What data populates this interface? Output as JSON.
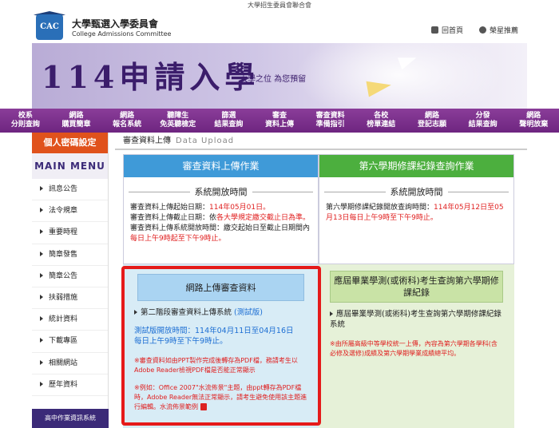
{
  "topbar": {
    "text": "大學招生委員會聯合會"
  },
  "header": {
    "logo_text": "CAC",
    "org_zh": "大學甄選入學委員會",
    "org_en": "College Admissions Committee",
    "home_label": "回首頁",
    "star_label": "榮星推薦"
  },
  "banner": {
    "title": "114申請入學",
    "subtitle": "大學之位 為您預留"
  },
  "nav": [
    {
      "line1": "校系",
      "line2": "分則查詢"
    },
    {
      "line1": "網路",
      "line2": "購買簡章"
    },
    {
      "line1": "網路",
      "line2": "報名系統"
    },
    {
      "line1": "聽障生",
      "line2": "免英聽檢定"
    },
    {
      "line1": "篩選",
      "line2": "結果查詢"
    },
    {
      "line1": "審查",
      "line2": "資料上傳"
    },
    {
      "line1": "審查資料",
      "line2": "準備指引"
    },
    {
      "line1": "各校",
      "line2": "榜單連結"
    },
    {
      "line1": "網路",
      "line2": "登記志願"
    },
    {
      "line1": "分發",
      "line2": "結果查詢"
    },
    {
      "line1": "網路",
      "line2": "聲明放棄"
    }
  ],
  "sidebar": {
    "header": "個人密碼設定",
    "menu_title": "MAIN MENU",
    "items": [
      "訊息公告",
      "法令規章",
      "重要時程",
      "簡章發售",
      "簡章公告",
      "扶弱措施",
      "統計資料",
      "下載專區",
      "相關網站",
      "歷年資料"
    ],
    "bottom": "高中作業資訊系統"
  },
  "page": {
    "title": "審查資料上傳",
    "title_en": "Data Upload"
  },
  "left_col": {
    "header": "審查資料上傳作業",
    "section_title": "系統開放時間",
    "start_label": "審查資料上傳起始日期：",
    "start_value": "114年05月01日。",
    "end_label": "審查資料上傳截止日期：",
    "end_prefix": "依",
    "end_value": "各大學規定繳交截止日為準。",
    "open_label": "審查資料上傳系統開放時間：",
    "open_text": "繳交起始日至截止日期間內",
    "open_value": "每日上午9時起至下午9時止。",
    "subbox": "網路上傳審查資料",
    "link_text": "第二階段審查資料上傳系統",
    "link_test": "(測試版)",
    "test_line1": "測試版開放時間：114年04月11日至04月16日",
    "test_line2": "每日上午9時至下午9時止。",
    "note1": "※審查資料如由PPT製作完成後轉存為PDF檔，務請考生以Adobe Reader檢視PDF檔是否能正常顯示",
    "note2": "※例如：Office 2007\"水流佈景\"主題，由ppt轉存為PDF檔時，Adobe Reader無法正常顯示，請考生避免使用該主題進行編輯。水流佈景範例"
  },
  "right_col": {
    "header": "第六學期修課紀錄查詢作業",
    "section_title": "系統開放時間",
    "open_text": "第六學期修課紀錄開放查詢時間：",
    "open_value": "114年05月12日至05月13日每日上午9時至下午9時止。",
    "subbox": "應屆畢業學測(或術科)考生查詢第六學期修課紀錄",
    "link_text": "應屆畢業學測(或術科)考生查詢第六學期修課紀錄系統",
    "note": "※由所屬高級中等學校統一上傳，內容為第六學期各學科(含必修及選修)成績及第六學期學業成績總平均。"
  }
}
